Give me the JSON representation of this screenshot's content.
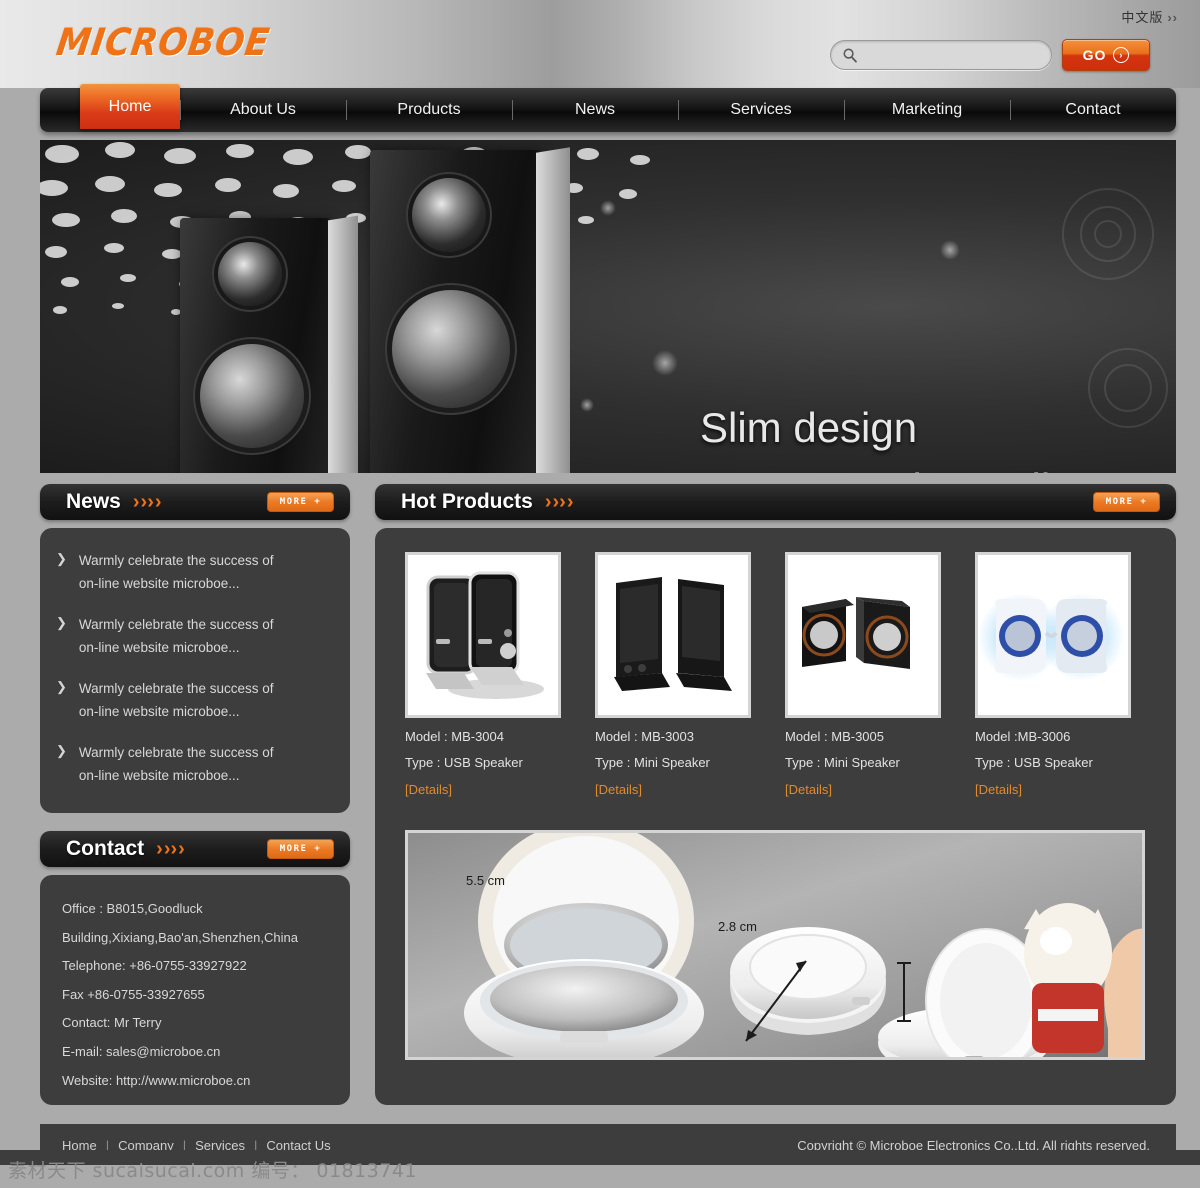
{
  "site": {
    "logo_text": "MICROBOE",
    "lang_link": "中文版",
    "lang_chevron": "››"
  },
  "search": {
    "placeholder": "",
    "value": "",
    "icon": "search-icon",
    "go_label": "GO",
    "go_arrow": "›"
  },
  "nav": {
    "items": [
      {
        "label": "Home",
        "active": true
      },
      {
        "label": "About Us",
        "active": false
      },
      {
        "label": "Products",
        "active": false
      },
      {
        "label": "News",
        "active": false
      },
      {
        "label": "Services",
        "active": false
      },
      {
        "label": "Marketing",
        "active": false
      },
      {
        "label": "Contact",
        "active": false
      }
    ]
  },
  "banner": {
    "line1": "Slim design",
    "line2": "super-popular audio"
  },
  "news": {
    "title": "News",
    "more_label": "MORE +",
    "items": [
      {
        "line1": "Warmly celebrate the success of",
        "line2": "on-line website microboe..."
      },
      {
        "line1": "Warmly celebrate the success of",
        "line2": "on-line website microboe..."
      },
      {
        "line1": "Warmly celebrate the success of",
        "line2": "on-line website microboe..."
      },
      {
        "line1": "Warmly celebrate the success of",
        "line2": "on-line website microboe..."
      }
    ]
  },
  "contact": {
    "title": "Contact",
    "more_label": "MORE +",
    "lines": [
      "Office : B8015,Goodluck",
      "Building,Xixiang,Bao'an,Shenzhen,China",
      "Telephone: +86-0755-33927922",
      "Fax +86-0755-33927655",
      "Contact: Mr Terry",
      "E-mail: sales@microboe.cn",
      "Website: http://www.microboe.cn"
    ]
  },
  "hot_products": {
    "title": "Hot Products",
    "more_label": "MORE +",
    "items": [
      {
        "model": "Model : MB-3004",
        "type": "Type : USB Speaker",
        "details": "[Details]",
        "image": "black-slim-speaker-pair"
      },
      {
        "model": "Model : MB-3003",
        "type": "Type : Mini Speaker",
        "details": "[Details]",
        "image": "black-flat-panel-speaker-pair"
      },
      {
        "model": "Model : MB-3005",
        "type": "Type : Mini Speaker",
        "details": "[Details]",
        "image": "black-cube-speaker-pair"
      },
      {
        "model": "Model :MB-3006",
        "type": "Type : USB Speaker",
        "details": "[Details]",
        "image": "white-blue-led-speaker-pair"
      }
    ]
  },
  "promo": {
    "dim_width": "5.5 cm",
    "dim_height": "2.8 cm",
    "image": "round-compact-white-speaker-photos"
  },
  "footer": {
    "links": [
      "Home",
      "Company",
      "Services",
      "Contact Us"
    ],
    "separator": "|",
    "copyright": "Copyright © Microboe Electronics Co.,Ltd. All rights reserved."
  },
  "watermark": {
    "text": "素材天下 sucaisucai.com  编号： 01813741"
  },
  "colors": {
    "accent_orange": "#ef7216",
    "nav_dark": "#161616",
    "panel_dark": "#3d3d3d",
    "page_gray": "#ababab",
    "details_link": "#e08a2e"
  }
}
